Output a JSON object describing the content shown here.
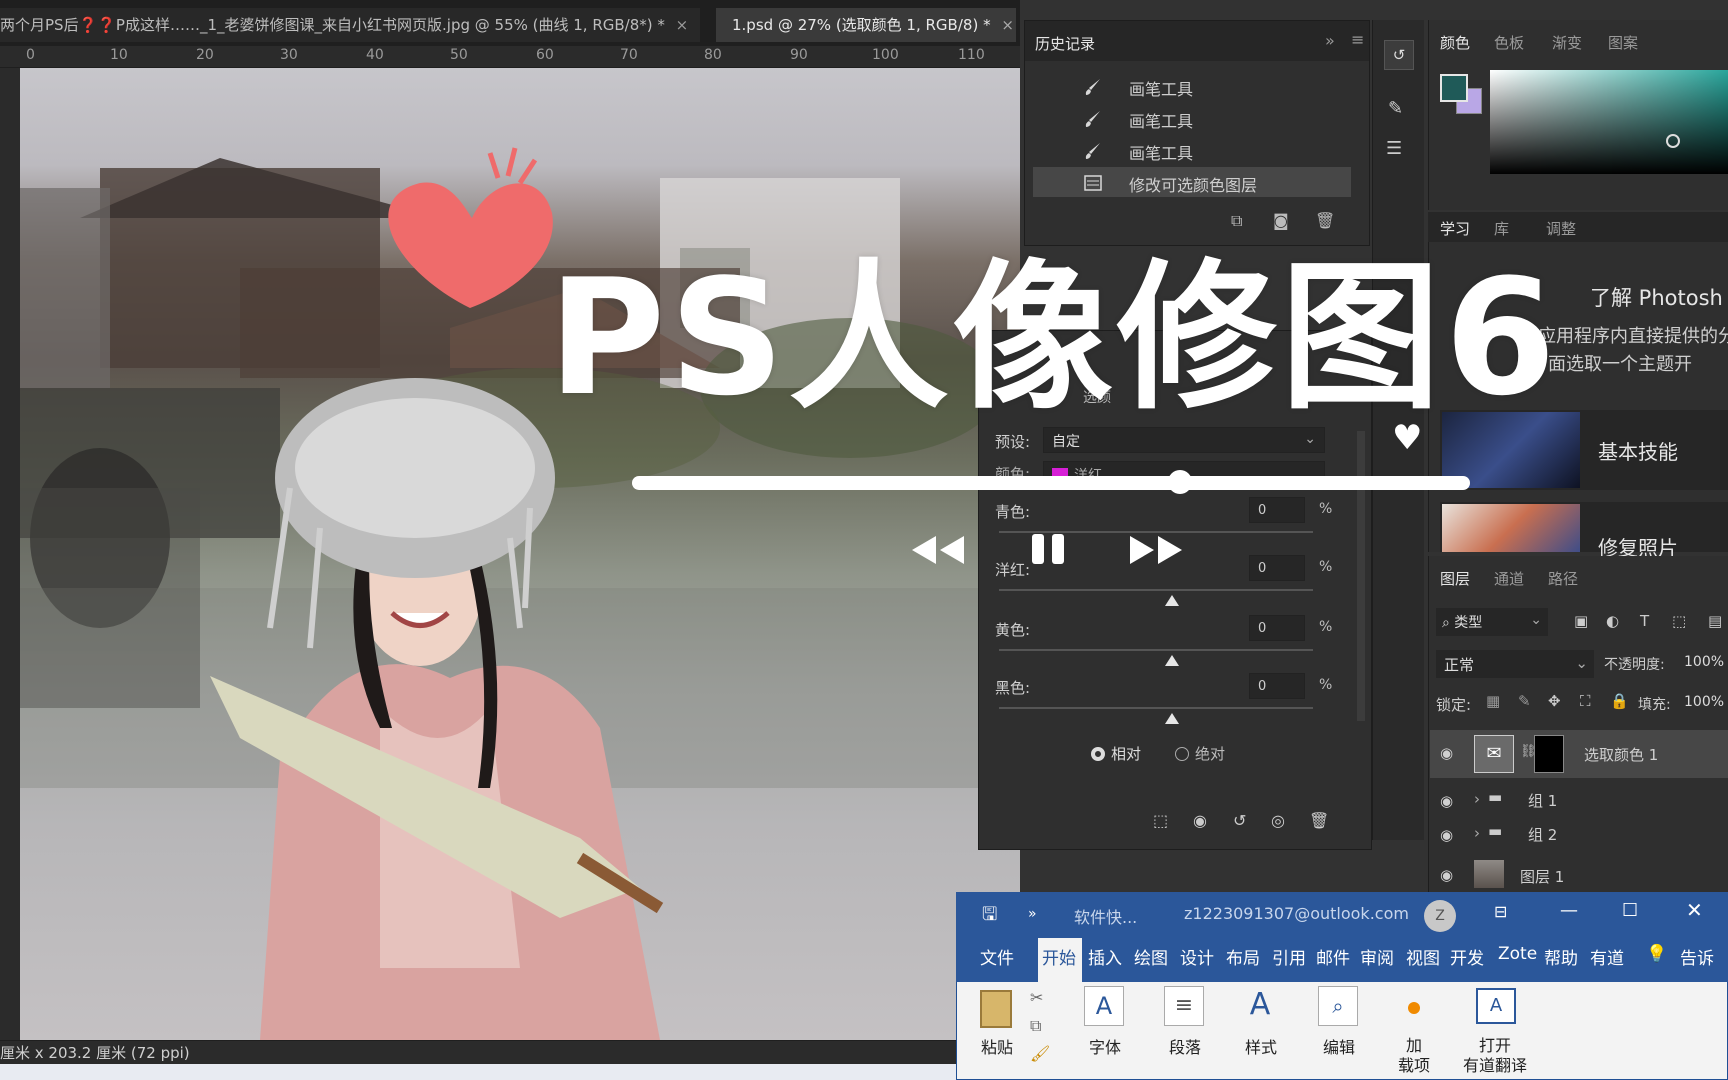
{
  "tabs": [
    {
      "label": "两个月PS后❓❓P成这样……_1_老婆饼修图课_来自小红书网页版.jpg @ 55% (曲线 1, RGB/8*) *",
      "close": "×"
    },
    {
      "label": "1.psd @ 27% (选取颜色 1, RGB/8) *",
      "close": "×"
    }
  ],
  "ruler_marks": [
    "0",
    "10",
    "20",
    "30",
    "40",
    "50",
    "60",
    "70",
    "80",
    "90",
    "100",
    "110"
  ],
  "overlay": {
    "title": "PS人像修图6"
  },
  "history": {
    "title": "历史记录",
    "collapse": "»",
    "menu": "≡",
    "items": [
      "画笔工具",
      "画笔工具",
      "画笔工具",
      "修改可选颜色图层"
    ]
  },
  "properties": {
    "hidden_label": "选颜",
    "preset_label": "预设:",
    "preset_value": "自定",
    "color_label": "颜色:",
    "color_value": "洋红",
    "color_swatch": "#d61fd6",
    "rows": [
      {
        "label": "青色:",
        "value": "0",
        "unit": "%"
      },
      {
        "label": "洋红:",
        "value": "0",
        "unit": "%"
      },
      {
        "label": "黄色:",
        "value": "0",
        "unit": "%"
      },
      {
        "label": "黑色:",
        "value": "0",
        "unit": "%"
      }
    ],
    "radio_relative": "相对",
    "radio_absolute": "绝对"
  },
  "color_panel": {
    "tabs": [
      "颜色",
      "色板",
      "渐变",
      "图案"
    ],
    "foreground": "#1f5a58",
    "background": "#b9a7e6"
  },
  "learn_panel": {
    "tabs": [
      "学习",
      "库",
      "调整"
    ],
    "heading": "了解 Photosh",
    "desc1": "在应用程序内直接提供的分",
    "desc2": "下面选取一个主题开",
    "cards": [
      "基本技能",
      "修复照片"
    ]
  },
  "layers_panel": {
    "tabs": [
      "图层",
      "通道",
      "路径"
    ],
    "filter_label": "类型",
    "blend_mode": "正常",
    "opacity_label": "不透明度:",
    "opacity_value": "100%",
    "lock_label": "锁定:",
    "fill_label": "填充:",
    "fill_value": "100%",
    "layers": [
      "选取颜色 1",
      "组 1",
      "组 2",
      "图层 1"
    ]
  },
  "status_bar": {
    "text": "厘米 x 203.2 厘米 (72 ppi)"
  },
  "word": {
    "doc_title": "软件快...",
    "account": "z1223091307@outlook.com",
    "avatar_letter": "Z",
    "tabs": [
      "文件",
      "开始",
      "插入",
      "绘图",
      "设计",
      "布局",
      "引用",
      "邮件",
      "审阅",
      "视图",
      "开发",
      "Zote",
      "帮助",
      "有道",
      "告诉"
    ],
    "ribbon": {
      "paste": "粘贴",
      "font": "字体",
      "paragraph": "段落",
      "styles": "样式",
      "editing": "编辑",
      "addins_1": "加",
      "addins_2": "载项",
      "youdao_1": "打开",
      "youdao_2": "有道翻译"
    }
  }
}
